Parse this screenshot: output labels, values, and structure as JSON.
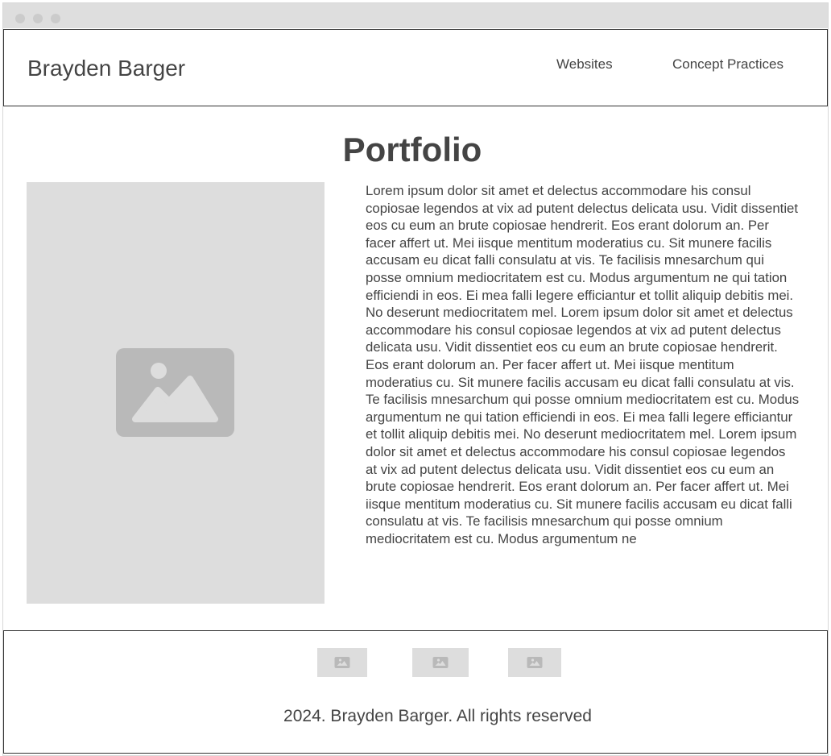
{
  "header": {
    "site_title": "Brayden Barger",
    "nav": [
      {
        "label": "Websites"
      },
      {
        "label": "Concept Practices"
      }
    ]
  },
  "main": {
    "heading": "Portfolio",
    "image_icon": "image-placeholder-icon",
    "body": "Lorem ipsum dolor sit amet et delectus accommodare his consul copiosae legendos at vix ad putent delectus delicata usu. Vidit dissentiet eos cu eum an brute copiosae hendrerit. Eos erant dolorum an. Per facer affert ut. Mei iisque mentitum moderatius cu. Sit munere facilis accusam eu dicat falli consulatu at vis. Te facilisis mnesarchum qui posse omnium mediocritatem est cu. Modus argumentum ne qui tation efficiendi in eos. Ei mea falli legere efficiantur et tollit aliquip debitis mei. No deserunt mediocritatem mel. Lorem ipsum dolor sit amet et delectus accommodare his consul copiosae legendos at vix ad putent delectus delicata usu. Vidit dissentiet eos cu eum an brute copiosae hendrerit. Eos erant dolorum an. Per facer affert ut. Mei iisque mentitum moderatius cu. Sit munere facilis accusam eu dicat falli consulatu at vis. Te facilisis mnesarchum qui posse omnium mediocritatem est cu. Modus argumentum ne qui tation efficiendi in eos. Ei mea falli legere efficiantur et tollit aliquip debitis mei. No deserunt mediocritatem mel. Lorem ipsum dolor sit amet et delectus accommodare his consul copiosae legendos at vix ad putent delectus delicata usu. Vidit dissentiet eos cu eum an brute copiosae hendrerit. Eos erant dolorum an. Per facer affert ut. Mei iisque mentitum moderatius cu. Sit munere facilis accusam eu dicat falli consulatu at vis. Te facilisis mnesarchum qui posse omnium mediocritatem est cu. Modus argumentum ne"
  },
  "footer": {
    "thumb_icon": "image-placeholder-icon",
    "copyright": "2024. Brayden Barger. All rights reserved"
  },
  "colors": {
    "text": "#444444",
    "placeholder_bg": "#dddddd",
    "placeholder_icon": "#b9b9b9",
    "border": "#333333",
    "chrome": "#dedede"
  }
}
